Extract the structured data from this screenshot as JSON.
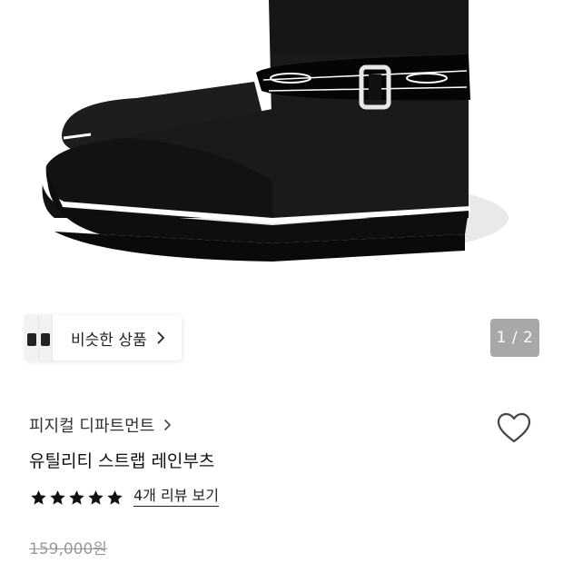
{
  "product": {
    "brand": "피지컬 디파트먼트",
    "name": "유틸리티 스트랩 레인부츠",
    "rating": 5,
    "review_link": "4개 리뷰 보기",
    "original_price": "159,000원"
  },
  "gallery": {
    "pager": "1 / 2",
    "similar_label": "비슷한 상품"
  },
  "icons": {
    "similar_chevron": "chevron-right-icon",
    "brand_chevron": "chevron-right-icon",
    "wishlist": "heart-outline-icon",
    "star": "star-filled-icon"
  },
  "colors": {
    "star": "#111111",
    "pager_bg": "#a8a8a8",
    "price_strike": "#999999"
  }
}
